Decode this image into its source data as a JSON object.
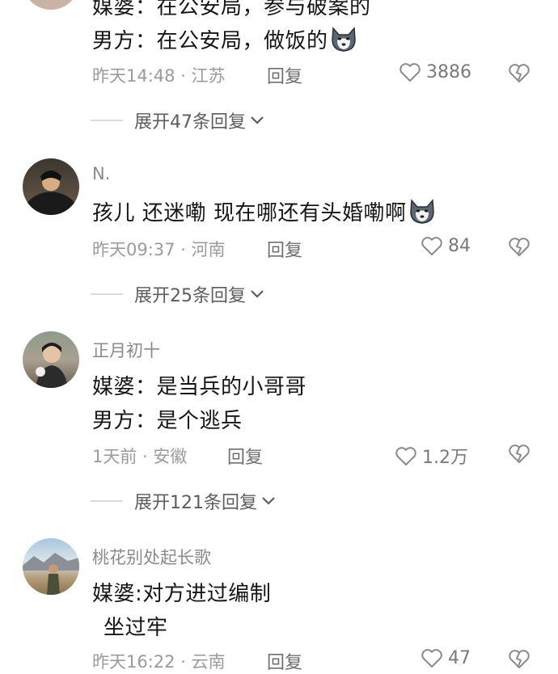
{
  "comments": [
    {
      "username": "",
      "lines": [
        "媒婆：在公安局，参与破案的",
        "男方：在公安局，做饭的"
      ],
      "time": "昨天14:48 · 江苏",
      "reply": "回复",
      "likes": "3886",
      "expand": "展开47条回复"
    },
    {
      "username": "N.",
      "lines": [
        "孩儿 还迷嘞 现在哪还有头婚嘞啊"
      ],
      "time": "昨天09:37 · 河南",
      "reply": "回复",
      "likes": "84",
      "expand": "展开25条回复"
    },
    {
      "username": "正月初十",
      "lines": [
        "媒婆：是当兵的小哥哥",
        "男方：是个逃兵"
      ],
      "time": "1天前 · 安徽",
      "reply": "回复",
      "likes": "1.2万",
      "expand": "展开121条回复"
    },
    {
      "username": "桃花别处起长歌",
      "lines": [
        "媒婆:对方进过编制",
        " 坐过牢"
      ],
      "time": "昨天16:22 · 云南",
      "reply": "回复",
      "likes": "47"
    }
  ],
  "icons": {
    "like": "heart-outline-icon",
    "dislike": "broken-heart-icon",
    "expand": "chevron-down-icon",
    "emoji": "husky-dog-emoji"
  },
  "colors": {
    "text": "#161616",
    "meta": "#9b9b9b",
    "username": "#8a8a8a"
  }
}
